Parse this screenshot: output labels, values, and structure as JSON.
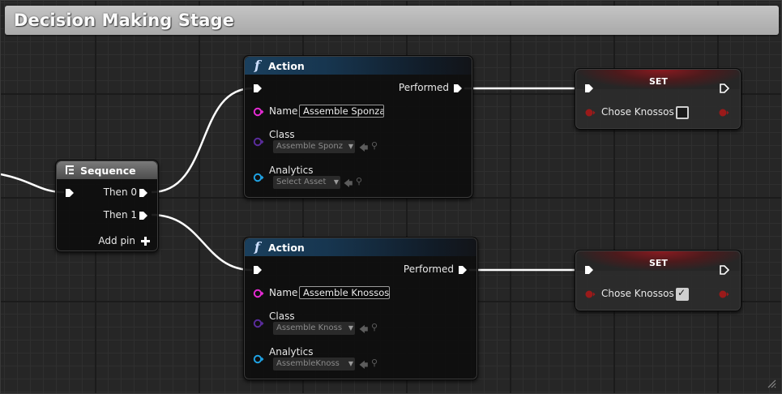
{
  "comment": {
    "title": "Decision Making Stage"
  },
  "sequence": {
    "title": "Sequence",
    "pins": [
      "Then 0",
      "Then 1"
    ],
    "add_pin": "Add pin"
  },
  "action_nodes": [
    {
      "title": "Action",
      "output_label": "Performed",
      "name_label": "Name",
      "name_value": "Assemble Sponza",
      "class_label": "Class",
      "class_value": "Assemble Sponz",
      "analytics_label": "Analytics",
      "analytics_value": "Select Asset"
    },
    {
      "title": "Action",
      "output_label": "Performed",
      "name_label": "Name",
      "name_value": "Assemble Knossos",
      "class_label": "Class",
      "class_value": "Assemble Knoss",
      "analytics_label": "Analytics",
      "analytics_value": "AssembleKnoss"
    }
  ],
  "set_nodes": [
    {
      "title": "SET",
      "var_label": "Chose Knossos",
      "checked": false
    },
    {
      "title": "SET",
      "var_label": "Chose Knossos",
      "checked": true
    }
  ],
  "colors": {
    "exec": "#ffffff",
    "name_pin": "#e52bd4",
    "class_pin": "#5a2c9c",
    "object_pin": "#1fa2e3",
    "bool_pin": "#9a1a1a",
    "action_header": "#1a3f5c",
    "set_header": "#8a1a20"
  },
  "icons": {
    "function": "function-icon",
    "sequence": "sequence-icon",
    "add": "plus-icon",
    "browse": "arrow-left-icon",
    "find": "magnifier-icon"
  }
}
